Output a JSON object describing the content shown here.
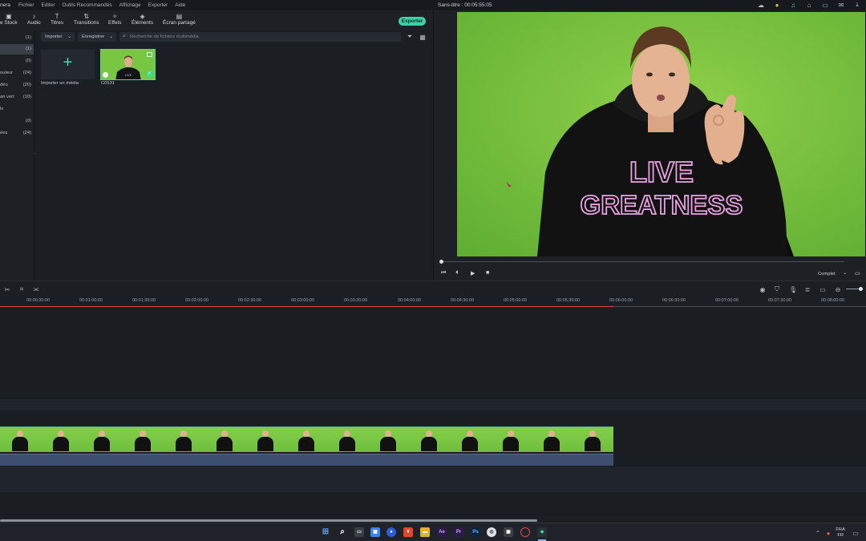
{
  "menubar": {
    "brand": "nera",
    "items": [
      "Fichier",
      "Editer",
      "Outils Recommandés",
      "Affichage",
      "Exporter",
      "Aide"
    ],
    "doc_title": "Sans-titre : 00:05:55:05"
  },
  "toolbar": {
    "tools": [
      {
        "label": "e Stock",
        "icon": "stock-icon"
      },
      {
        "label": "Audio",
        "icon": "music-note-icon"
      },
      {
        "label": "Titres",
        "icon": "text-icon"
      },
      {
        "label": "Transitions",
        "icon": "transition-icon"
      },
      {
        "label": "Effets",
        "icon": "effects-icon"
      },
      {
        "label": "Éléments",
        "icon": "elements-icon"
      },
      {
        "label": "Écran partagé",
        "icon": "split-screen-icon"
      }
    ],
    "export_label": "Exporter"
  },
  "leftpanel": {
    "rows": [
      {
        "label": "",
        "count": "(1)",
        "selected": false
      },
      {
        "label": "",
        "count": "(1)",
        "selected": true
      },
      {
        "label": "",
        "count": "(0)",
        "selected": false
      },
      {
        "label": "ouleur",
        "count": "(24)",
        "selected": false
      },
      {
        "label": "déo",
        "count": "(20)",
        "selected": false
      },
      {
        "label": "an vert",
        "count": "(10)",
        "selected": false
      },
      {
        "label": "ls",
        "count": "",
        "selected": false
      },
      {
        "label": "",
        "count": "(0)",
        "selected": false
      },
      {
        "label": "ées",
        "count": "(24)",
        "selected": false
      }
    ]
  },
  "media": {
    "import_dropdown": "Importer",
    "record_dropdown": "Enregistrer",
    "search_placeholder": "Recherche de fichiers multimédia",
    "import_tile_label": "Importer un média",
    "clip_label": "C0531"
  },
  "preview": {
    "quality": "Complet",
    "hoodie_text_1": "LIVE",
    "hoodie_text_2": "GREATNESS"
  },
  "ruler": {
    "ticks": [
      "00:00:30:00",
      "00:01:00:00",
      "00:01:30:00",
      "00:02:00:00",
      "00:02:30:00",
      "00:03:00:00",
      "00:03:30:00",
      "00:04:00:00",
      "00:04:30:00",
      "00:05:00:00",
      "00:05:30:00",
      "00:06:00:00",
      "00:06:30:00",
      "00:07:00:00",
      "00:07:30:00",
      "00:08:00:00"
    ]
  },
  "taskbar": {
    "lang_top": "FRA",
    "lang_bottom": "FR"
  },
  "colors": {
    "accent": "#3fd1a6",
    "green_screen": "#77c43e",
    "playhead_red": "#e0463f",
    "audio_track": "#3d4e6e"
  }
}
